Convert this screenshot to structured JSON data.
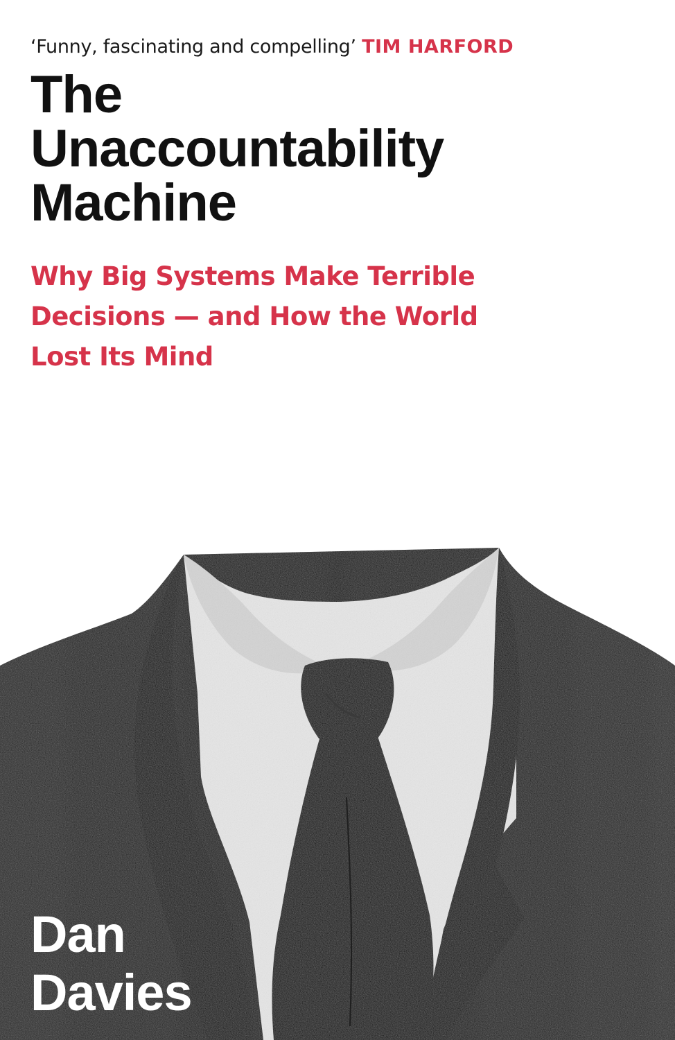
{
  "cover": {
    "quote": {
      "text": "‘Funny, fascinating and compelling’",
      "attribution": "TIM HARFORD"
    },
    "title_lines": [
      "The",
      "Unaccountability",
      "Machine"
    ],
    "subtitle_lines": [
      "Why Big Systems Make Terrible",
      "Decisions — and How the World",
      "Lost Its Mind"
    ],
    "author_lines": [
      "Dan",
      "Davies"
    ],
    "colors": {
      "background": "#ffffff",
      "title": "#111111",
      "accent": "#d6334a",
      "suit": "#1c1c1c",
      "shirt": "#e6e6e6",
      "tie": "#0d0d0d",
      "author": "#ffffff"
    },
    "illustration": {
      "icon": "headless-suit-icon"
    }
  }
}
